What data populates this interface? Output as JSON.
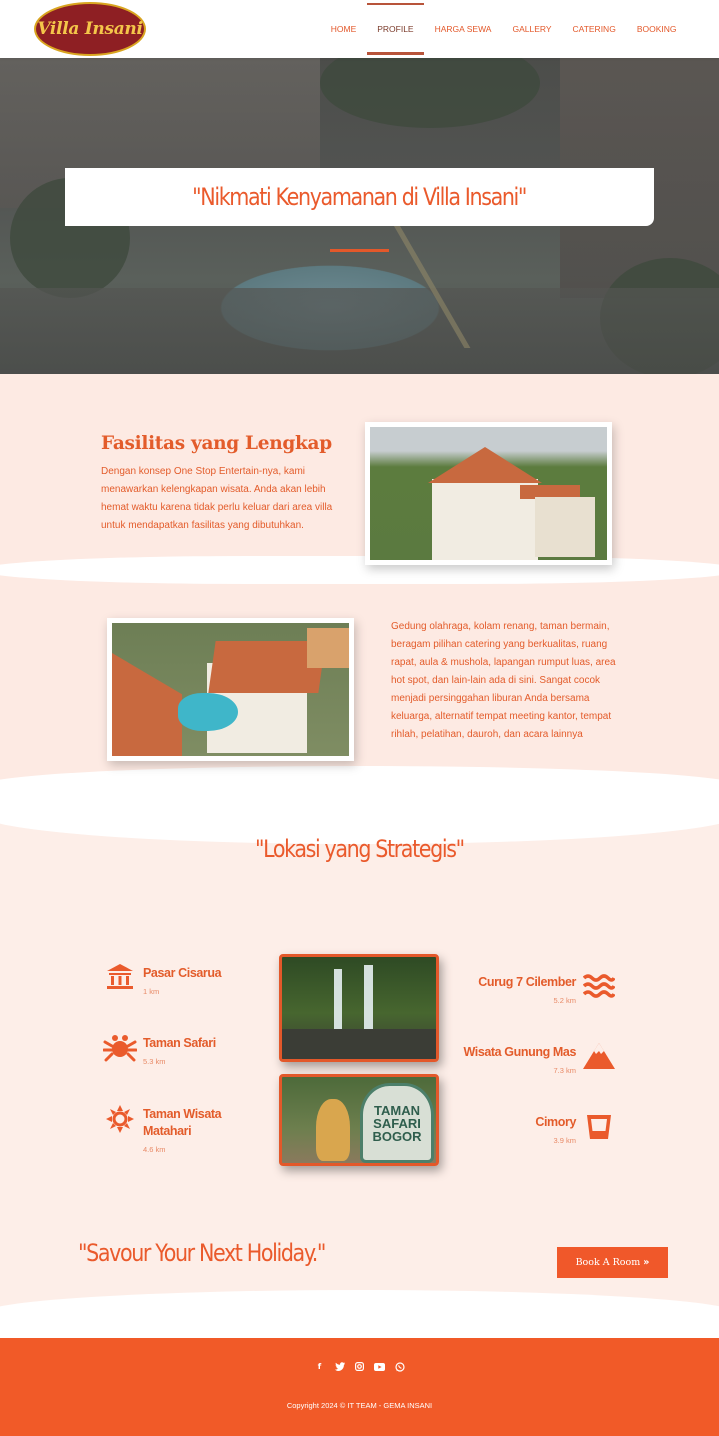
{
  "brand": {
    "logo_text": "Villa Insani"
  },
  "nav": {
    "items": [
      {
        "label": "HOME"
      },
      {
        "label": "PROFILE",
        "active": true
      },
      {
        "label": "HARGA SEWA"
      },
      {
        "label": "GALLERY"
      },
      {
        "label": "CATERING"
      },
      {
        "label": "BOOKING"
      }
    ]
  },
  "hero": {
    "title": "\"Nikmati Kenyamanan di Villa Insani\""
  },
  "facilities": {
    "title": "Fasilitas yang Lengkap",
    "text1": "Dengan konsep One Stop Entertain-nya, kami menawarkan kelengkapan wisata. Anda akan lebih hemat waktu karena tidak perlu keluar dari area villa untuk mendapatkan fasilitas yang dibutuhkan.",
    "text2": "Gedung olahraga, kolam renang, taman bermain, beragam pilihan catering yang berkualitas, ruang rapat, aula & mushola, lapangan rumput luas, area hot spot, dan lain-lain ada di sini. Sangat cocok menjadi persinggahan liburan Anda bersama keluarga, alternatif tempat meeting kantor, tempat rihlah, pelatihan, dauroh, dan acara lainnya"
  },
  "location": {
    "title": "\"Lokasi yang Strategis\"",
    "left": [
      {
        "name": "Pasar Cisarua",
        "distance": "1 km",
        "icon": "landmark-icon"
      },
      {
        "name": "Taman Safari",
        "distance": "5.3 km",
        "icon": "spider-icon"
      },
      {
        "name": "Taman Wisata Matahari",
        "distance": "4.6 km",
        "icon": "sun-icon"
      }
    ],
    "right": [
      {
        "name": "Curug 7 Cilember",
        "distance": "5.2 km",
        "icon": "water-icon"
      },
      {
        "name": "Wisata Gunung Mas",
        "distance": "7.3 km",
        "icon": "mountain-icon"
      },
      {
        "name": "Cimory",
        "distance": "3.9 km",
        "icon": "glass-icon"
      }
    ],
    "sign_text": "TAMAN SAFARI BOGOR"
  },
  "cta": {
    "text": "\"Savour Your Next Holiday.\"",
    "button": "Book A Room",
    "button_icon": "»"
  },
  "footer": {
    "social": [
      {
        "icon": "facebook-icon",
        "glyph": "f"
      },
      {
        "icon": "twitter-icon",
        "glyph": "t"
      },
      {
        "icon": "instagram-icon",
        "glyph": "◎"
      },
      {
        "icon": "youtube-icon",
        "glyph": "▶"
      },
      {
        "icon": "whatsapp-icon",
        "glyph": "✆"
      }
    ],
    "copyright": "Copyright 2024 © IT TEAM - GEMA INSANI"
  },
  "colors": {
    "accent": "#f15a28",
    "peach": "#fdeae3",
    "logo_bg": "#8e1f23",
    "logo_text": "#f4c64a"
  }
}
